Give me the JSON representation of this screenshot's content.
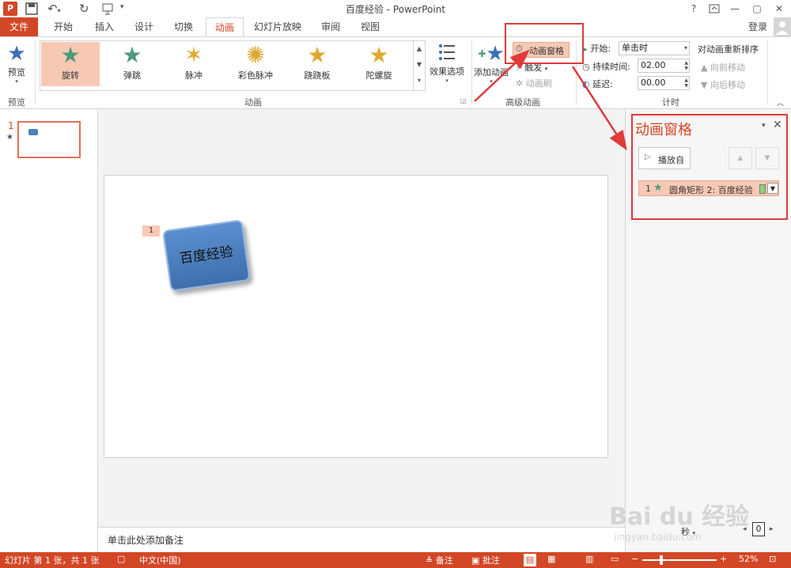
{
  "window": {
    "title": "百度经验 - PowerPoint",
    "help": "?",
    "minimize": "—",
    "restore": "▢",
    "close": "✕"
  },
  "qat": {
    "app_icon": "P",
    "save_icon": "save-icon",
    "undo_icon": "undo-icon",
    "redo_icon": "redo-icon"
  },
  "tabs": [
    {
      "label": "文件"
    },
    {
      "label": "开始"
    },
    {
      "label": "插入"
    },
    {
      "label": "设计"
    },
    {
      "label": "切换"
    },
    {
      "label": "动画"
    },
    {
      "label": "幻灯片放映"
    },
    {
      "label": "审阅"
    },
    {
      "label": "视图"
    }
  ],
  "account": {
    "login": "登录"
  },
  "ribbon": {
    "preview": {
      "label": "预览",
      "group": "预览"
    },
    "animations": {
      "group": "动画",
      "items": [
        {
          "label": "旋转",
          "color": "#4e9a7a"
        },
        {
          "label": "弹跳",
          "color": "#4e9a7a"
        },
        {
          "label": "脉冲",
          "color": "#e0a830"
        },
        {
          "label": "彩色脉冲",
          "color": "#e0a830"
        },
        {
          "label": "跷跷板",
          "color": "#e0a830"
        },
        {
          "label": "陀螺旋",
          "color": "#e0a830"
        }
      ]
    },
    "effect_options": "效果选项",
    "advanced": {
      "group": "高级动画",
      "add": "添加动画",
      "pane": "动画窗格",
      "trigger": "触发",
      "painter": "动画刷"
    },
    "timing": {
      "group": "计时",
      "start_label": "开始:",
      "start_value": "单击时",
      "duration_label": "持续时间:",
      "duration_value": "02.00",
      "delay_label": "延迟:",
      "delay_value": "00.00",
      "reorder": "对动画重新排序",
      "move_earlier": "向前移动",
      "move_later": "向后移动"
    }
  },
  "thumbs": [
    {
      "number": "1",
      "star": "★"
    }
  ],
  "slide": {
    "shape_text": "百度经验",
    "anim_tag": "1"
  },
  "notes": {
    "placeholder": "单击此处添加备注"
  },
  "pane": {
    "title": "动画窗格",
    "play": "播放自",
    "items": [
      {
        "order": "1",
        "name": "圆角矩形 2: 百度经验"
      }
    ],
    "seconds": "秒",
    "timeline_zero": "0"
  },
  "status": {
    "slide_info": "幻灯片 第 1 张，共 1 张",
    "language": "中文(中国)",
    "notes": "备注",
    "comments": "批注",
    "zoom": "52%"
  },
  "watermark": {
    "text": "Bai du 经验",
    "url": "jingyan.baidu.com"
  },
  "colors": {
    "accent": "#d24726",
    "highlight": "#f7c9b5",
    "callout": "#e03a3a",
    "shape": "#4f81bd"
  }
}
